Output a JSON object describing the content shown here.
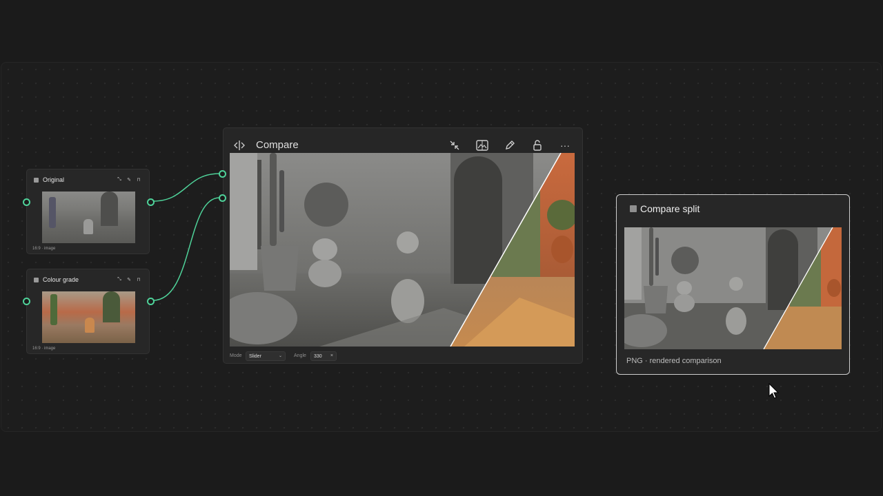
{
  "nodes": {
    "original": {
      "title": "Original",
      "meta": "16:9 · image"
    },
    "colour_grade": {
      "title": "Colour grade",
      "meta": "16:9 · image"
    }
  },
  "compare": {
    "title": "Compare",
    "mode_label": "Mode",
    "mode_value": "Slider",
    "angle_label": "Angle",
    "angle_value": "330",
    "angle_clear": "×"
  },
  "output": {
    "title": "Compare split",
    "caption": "PNG · rendered comparison"
  },
  "colors": {
    "port": "#4fd39a",
    "connector": "#4fd39a",
    "background": "#1b1b1b"
  }
}
